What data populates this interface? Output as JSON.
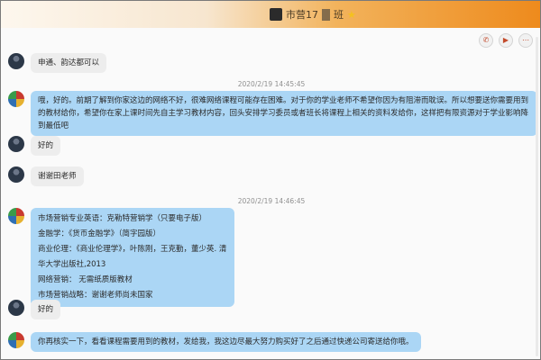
{
  "window": {
    "title": "市营17",
    "title_suffix": "班",
    "star": "★"
  },
  "toolbar": {
    "call_icon": "phone-icon",
    "video_icon": "video-camera-icon",
    "more_icon": "more-icon"
  },
  "messages": [
    {
      "text": "申通、韵达都可以"
    },
    {
      "text": "哦，好的。前期了解到你家这边的网络不好，很难网络课程可能存在困难。对于你的学业老师不希望你因为有阻滞而耽误。所以想要送你需要用到的教材给你，希望你在家上课时间先自主学习教材内容，回头安排学习委员或者班长将课程上相关的资料发给你，这样把有限资源对于学业影响降到最低吧"
    },
    {
      "text": "好的"
    },
    {
      "text": "谢谢田老师"
    },
    {
      "lines": [
        "市场营销专业英语：克勒特营销学（只要电子版）",
        "金融学：《货币金融学》（简字园版）",
        "商业伦理：《商业伦理学》，叶陈刚，王克勤，董少英. 清华大学出版社,2013",
        "网络营销：  无需纸质版教材",
        "市场营销战略：谢谢老师尚未国家"
      ]
    },
    {
      "text": "好的"
    },
    {
      "text": "你再核实一下，看看课程需要用到的教材，发给我，我这边尽最大努力购买好了之后通过快递公司寄送给你哦。"
    }
  ],
  "timestamps": [
    "2020/2/19 14:45:45",
    "2020/2/19 14:46:45"
  ]
}
